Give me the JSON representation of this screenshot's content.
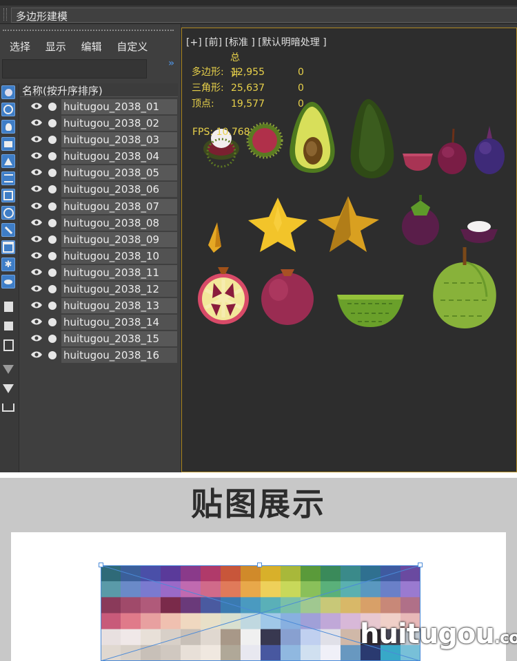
{
  "ribbon": {
    "title": "多边形建模"
  },
  "scene_explorer": {
    "menu": [
      "选择",
      "显示",
      "编辑",
      "自定义"
    ],
    "column_header": "名称(按升序排序)",
    "items": [
      "huitugou_2038_01",
      "huitugou_2038_02",
      "huitugou_2038_03",
      "huitugou_2038_04",
      "huitugou_2038_05",
      "huitugou_2038_06",
      "huitugou_2038_07",
      "huitugou_2038_08",
      "huitugou_2038_09",
      "huitugou_2038_10",
      "huitugou_2038_11",
      "huitugou_2038_12",
      "huitugou_2038_13",
      "huitugou_2038_14",
      "huitugou_2038_15",
      "huitugou_2038_16"
    ]
  },
  "viewport": {
    "label": "[+] [前] [标准 ] [默认明暗处理 ]",
    "stats": {
      "total_label": "总计",
      "polys_label": "多边形:",
      "polys_value": "12,955",
      "polys_sel": "0",
      "tris_label": "三角形:",
      "tris_value": "25,637",
      "tris_sel": "0",
      "verts_label": "顶点:",
      "verts_value": "19,577",
      "verts_sel": "0"
    },
    "fps_label": "FPS:",
    "fps_value": "10.768",
    "accent_color": "#e8d14a"
  },
  "texture_section": {
    "title": "贴图展示",
    "watermark_main": "huitugou",
    "watermark_suffix": ".com"
  }
}
